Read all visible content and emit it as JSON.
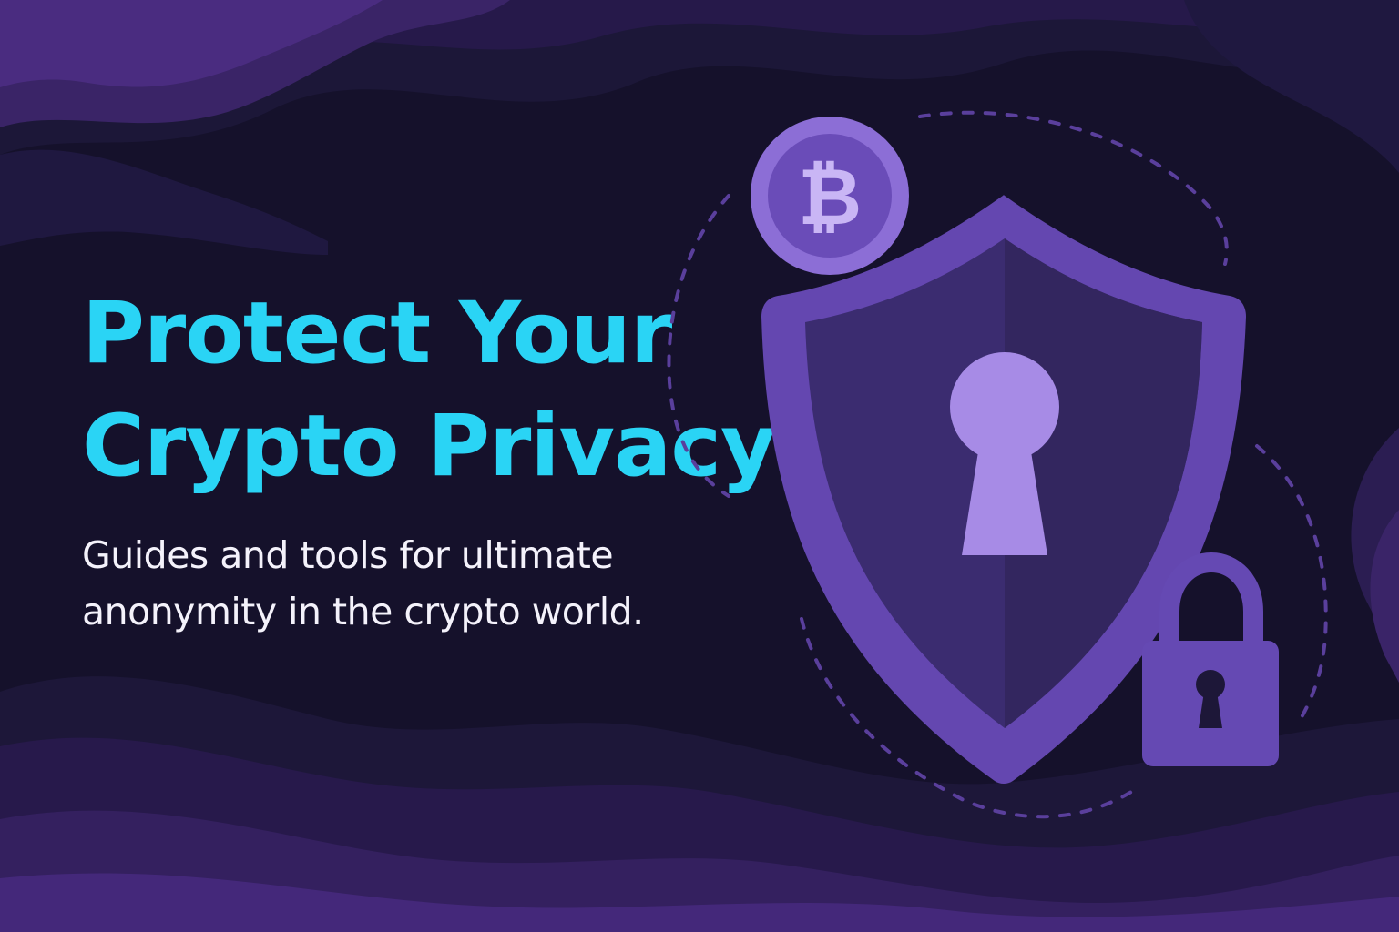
{
  "hero": {
    "headline_line1": "Protect Your",
    "headline_line2": "Crypto Privacy",
    "subtitle_line1": "Guides and tools for ultimate",
    "subtitle_line2": "anonymity in the crypto world."
  },
  "icons": {
    "coin": "bitcoin-coin-icon",
    "shield": "shield-keyhole-icon",
    "padlock": "padlock-icon",
    "orbit": "dashed-orbit"
  },
  "colors": {
    "background": "#15112b",
    "headline": "#2ad4f5",
    "subtitle": "#f4f2fb",
    "shield_outer": "#6447b0",
    "shield_inner_left": "#3b2c70",
    "shield_inner_right": "#33265f",
    "keyhole": "#a78be6",
    "coin": "#8c6ed6",
    "padlock": "#6549b3"
  }
}
